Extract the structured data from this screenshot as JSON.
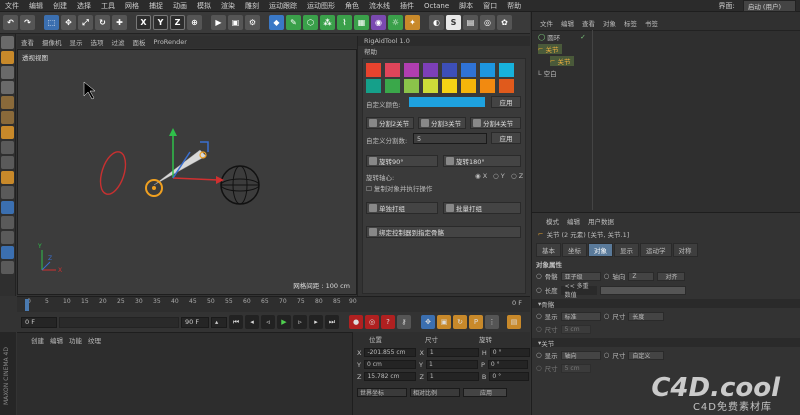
{
  "menubar": {
    "items": [
      "文件",
      "编辑",
      "创建",
      "选择",
      "工具",
      "网格",
      "捕捉",
      "动画",
      "模拟",
      "渲染",
      "雕刻",
      "运动跟踪",
      "运动图形",
      "角色",
      "流水线",
      "插件",
      "Octane",
      "脚本",
      "窗口",
      "帮助"
    ],
    "interface_label": "界面:",
    "interface_value": "启动 (用户)"
  },
  "viewport": {
    "menu": [
      "查看",
      "摄像机",
      "显示",
      "选项",
      "过滤",
      "面板",
      "ProRender"
    ],
    "label": "透视视图",
    "grid_label": "网格间距 : 100 cm"
  },
  "timeline": {
    "ticks": [
      "0",
      "5",
      "10",
      "15",
      "20",
      "25",
      "30",
      "35",
      "40",
      "45",
      "50",
      "55",
      "60",
      "65",
      "70",
      "75",
      "80",
      "85",
      "90"
    ],
    "end_frame": "0 F"
  },
  "transport": {
    "current_frame": "0 F",
    "start_frame": "0 F",
    "end_frame": "90 F",
    "buttons": [
      "◀◀",
      "◀▌",
      "◀",
      "▶",
      "▶",
      "▌▶",
      "▶▶"
    ]
  },
  "materials": {
    "menu": [
      "创建",
      "编辑",
      "功能",
      "纹理"
    ]
  },
  "brand": "MAXON CINEMA 4D",
  "coordinates": {
    "headers": {
      "pos": "位置",
      "size": "尺寸",
      "rot": "旋转"
    },
    "rows": [
      {
        "axis": "X",
        "pos": "-201.855 cm",
        "size": "1",
        "rot_axis": "H",
        "rot": "0 °"
      },
      {
        "axis": "Y",
        "pos": "0 cm",
        "size": "1",
        "rot_axis": "P",
        "rot": "0 °"
      },
      {
        "axis": "Z",
        "pos": "15.782 cm",
        "size": "1",
        "rot_axis": "B",
        "rot": "0 °"
      }
    ],
    "coord_mode": "世界坐标",
    "size_mode": "相对比例",
    "apply": "应用"
  },
  "rigtool": {
    "title": "RigAidTool 1.0",
    "help": "帮助",
    "swatches_row1": [
      "#e8432e",
      "#e0455a",
      "#b03eb0",
      "#7d3fb8",
      "#3d4fb8",
      "#2f73d6",
      "#1d96e0",
      "#17b2dc"
    ],
    "swatches_row2": [
      "#15a08a",
      "#3aa84a",
      "#8bc34a",
      "#cddc39",
      "#f5d315",
      "#f5b50a",
      "#f28a10",
      "#e05a1c"
    ],
    "custom_color_label": "自定义颜色:",
    "custom_color": "#1ea2e0",
    "apply": "应用",
    "split2": "分割2关节",
    "split3": "分割3关节",
    "split4": "分割4关节",
    "custom_split_label": "自定义分割数:",
    "custom_split_value": "5",
    "rotate90": "旋转90°",
    "rotate180": "旋转180°",
    "rot_axis_label": "旋转轴心:",
    "axes": [
      "X",
      "Y",
      "Z"
    ],
    "copy_exec": "复制对象并执行操作",
    "single_group": "单独打组",
    "batch_group": "批量打组",
    "bind_ctrl": "绑定控制器到指定骨骼"
  },
  "object_manager": {
    "menu": [
      "文件",
      "编辑",
      "查看",
      "对象",
      "标签",
      "书签"
    ],
    "items": [
      {
        "name": "圆环",
        "indent": 0
      },
      {
        "name": "关节",
        "indent": 0
      },
      {
        "name": "关节",
        "indent": 1
      },
      {
        "name": "空白",
        "indent": 0
      }
    ]
  },
  "attributes": {
    "menu": [
      "模式",
      "编辑",
      "用户数据"
    ],
    "title": "关节 (2 元素) [关节, 关节.1]",
    "tabs": [
      "基本",
      "坐标",
      "对象",
      "显示",
      "运动学",
      "对称"
    ],
    "active_tab": "对象",
    "section_object": "对象属性",
    "bone_label": "骨骼",
    "bone_value": "亚子级",
    "axis_label": "轴向",
    "axis_value": "Z",
    "align": "对齐",
    "length_label": "长度",
    "length_value": "<< 多重数值",
    "section_bone": "骨骼",
    "display_label": "显示",
    "display_value": "标准",
    "size_label": "尺寸",
    "size_value": "长度",
    "size_field_label": "尺寸",
    "size_field_value": "5 cm",
    "section_joint": "关节",
    "joint_display_value": "轴向",
    "joint_size_value": "自定义",
    "joint_size_field": "5 cm"
  },
  "watermark": {
    "logo": "C4D.cool",
    "sub": "C4D免费素材库"
  },
  "colors": {
    "accent": "#4a7ab0",
    "bg": "#333333"
  }
}
